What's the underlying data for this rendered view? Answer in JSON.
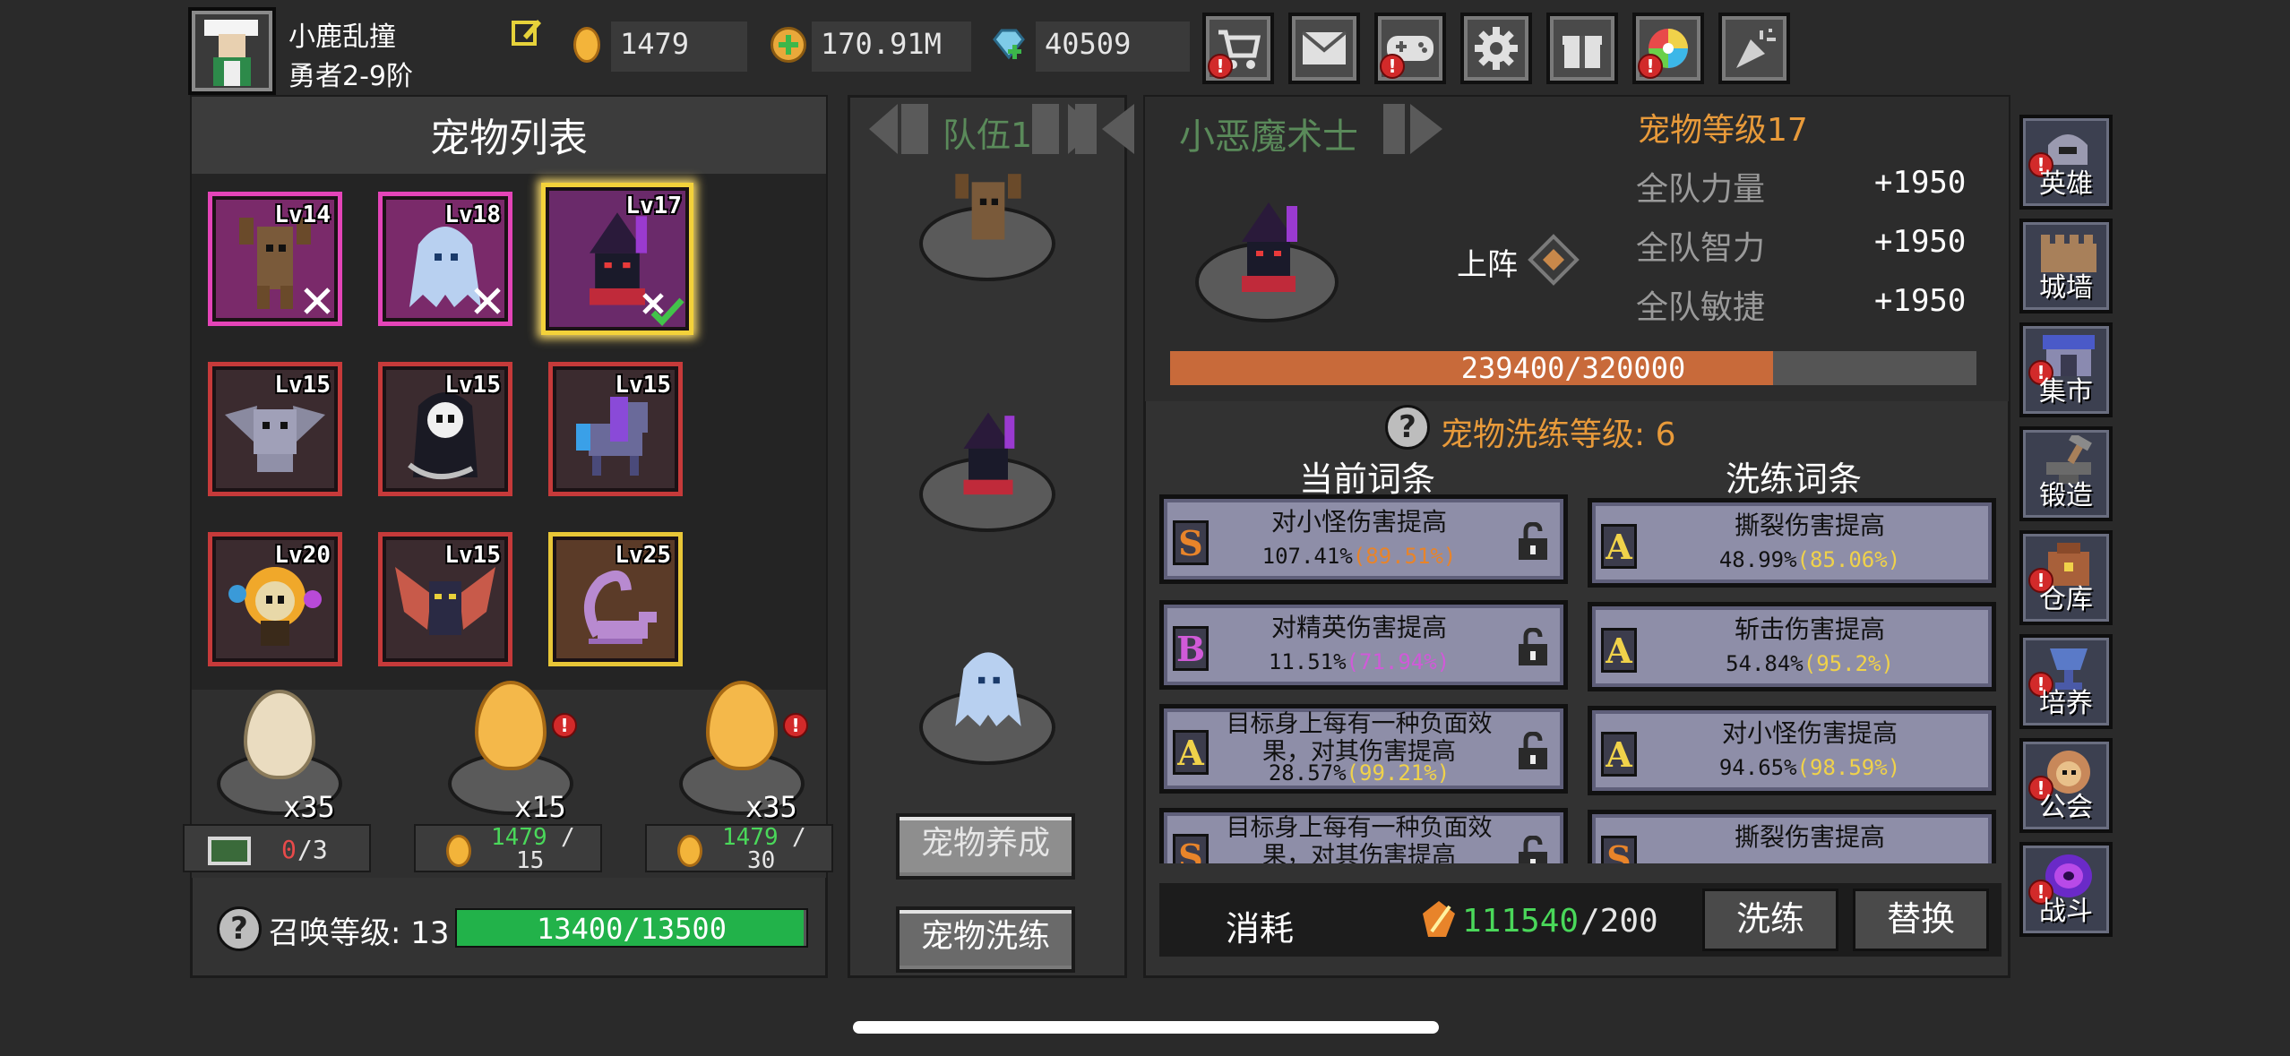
{
  "player": {
    "name": "小鹿乱撞",
    "title": "勇者2-9阶"
  },
  "currencies": {
    "gold_egg": "1479",
    "coins": "170.91M",
    "gems": "40509"
  },
  "top_icons": [
    "cart-icon",
    "mail-icon",
    "gamepad-icon",
    "settings-gear-icon",
    "gift-icon",
    "color-wheel-icon",
    "party-popper-icon"
  ],
  "pet_list": {
    "title": "宠物列表",
    "pets": [
      {
        "level": "Lv14",
        "name": "treant"
      },
      {
        "level": "Lv18",
        "name": "ice-ghost"
      },
      {
        "level": "Lv17",
        "name": "imp-wizard"
      },
      {
        "level": "Lv15",
        "name": "bat-cat"
      },
      {
        "level": "Lv15",
        "name": "grim-reaper"
      },
      {
        "level": "Lv15",
        "name": "galaxy-pony"
      },
      {
        "level": "Lv20",
        "name": "flame-skull"
      },
      {
        "level": "Lv15",
        "name": "demon-bat"
      },
      {
        "level": "Lv25",
        "name": "scorpion"
      }
    ],
    "eggs": [
      {
        "count": "x35",
        "cost_a": "0",
        "cost_b": "/3"
      },
      {
        "count": "x15",
        "cost_a": "1479",
        "cost_b": "/",
        "cost_c": "15"
      },
      {
        "count": "x35",
        "cost_a": "1479",
        "cost_b": "/",
        "cost_c": "30"
      }
    ],
    "summon_label": "召唤等级: 13",
    "summon_progress": "13400/13500",
    "summon_fraction": 0.9926
  },
  "team": {
    "label": "队伍1",
    "btn_raise": "宠物养成",
    "btn_refine": "宠物洗练"
  },
  "pet_detail": {
    "name": "小恶魔术士",
    "level_label": "宠物等级17",
    "deploy_label": "上阵",
    "stats": [
      {
        "label": "全队力量",
        "value": "+1950"
      },
      {
        "label": "全队智力",
        "value": "+1950"
      },
      {
        "label": "全队敏捷",
        "value": "+1950"
      }
    ],
    "exp": "239400/320000",
    "exp_fraction": 0.748,
    "refine_level_label": "宠物洗练等级: 6",
    "current_header": "当前词条",
    "refine_header": "洗练词条",
    "current_affixes": [
      {
        "grade": "S",
        "name": "对小怪伤害提高",
        "value": "107.41%",
        "max": "(89.51%)"
      },
      {
        "grade": "B",
        "name": "对精英伤害提高",
        "value": "11.51%",
        "max": "(71.94%)"
      },
      {
        "grade": "A",
        "name": "目标身上每有一种负面效果，对其伤害提高",
        "value": "28.57%",
        "max": "(99.21%)"
      },
      {
        "grade": "S",
        "name": "目标身上每有一种负面效果，对其伤害提高",
        "value": "",
        "max": ""
      }
    ],
    "refine_affixes": [
      {
        "grade": "A",
        "name": "撕裂伤害提高",
        "value": "48.99%",
        "max": "(85.06%)"
      },
      {
        "grade": "A",
        "name": "斩击伤害提高",
        "value": "54.84%",
        "max": "(95.2%)"
      },
      {
        "grade": "A",
        "name": "对小怪伤害提高",
        "value": "94.65%",
        "max": "(98.59%)"
      },
      {
        "grade": "S",
        "name": "撕裂伤害提高",
        "value": "",
        "max": ""
      }
    ],
    "cost_label": "消耗",
    "cost_have": "111540",
    "cost_need": "/200",
    "btn_refine": "洗练",
    "btn_replace": "替换"
  },
  "right_menu": [
    "英雄",
    "城墙",
    "集市",
    "锻造",
    "仓库",
    "培养",
    "公会",
    "战斗"
  ],
  "colors": {
    "green": "#22b24a",
    "orange": "#e89a3a",
    "exp_bar": "#c86a3a",
    "yellow": "#f0d24a",
    "magenta": "#d05ad8",
    "accent_s": "#e8842a"
  }
}
